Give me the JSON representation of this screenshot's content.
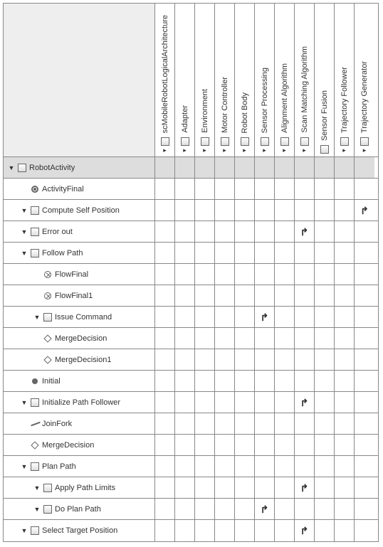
{
  "columns": [
    {
      "label": "scMobileRobotLogicalArchitecture",
      "has_arrow": true
    },
    {
      "label": "Adapter",
      "has_arrow": true
    },
    {
      "label": "Environment",
      "has_arrow": true
    },
    {
      "label": "Motor Controller",
      "has_arrow": true
    },
    {
      "label": "Robot Body",
      "has_arrow": true
    },
    {
      "label": "Sensor Processing",
      "has_arrow": true
    },
    {
      "label": "Alignment Algorithm",
      "has_arrow": true
    },
    {
      "label": "Scan Matching Algorithm",
      "has_arrow": true
    },
    {
      "label": "Sensor Fusion",
      "has_arrow": false
    },
    {
      "label": "Trajectory Follower",
      "has_arrow": true
    },
    {
      "label": "Trajectory Generator",
      "has_arrow": true
    }
  ],
  "rows": [
    {
      "label": "RobotActivity",
      "indent": 0,
      "expander": true,
      "icon": "checkbox",
      "shaded": true,
      "marks": {}
    },
    {
      "label": "ActivityFinal",
      "indent": 1,
      "expander": false,
      "icon": "bullseye",
      "shaded": false,
      "marks": {}
    },
    {
      "label": "Compute Self Position",
      "indent": 1,
      "expander": true,
      "icon": "checkbox",
      "shaded": false,
      "marks": {
        "10": true
      }
    },
    {
      "label": "Error out",
      "indent": 1,
      "expander": true,
      "icon": "checkbox",
      "shaded": false,
      "marks": {
        "7": true
      }
    },
    {
      "label": "Follow Path",
      "indent": 1,
      "expander": true,
      "icon": "checkbox",
      "shaded": false,
      "marks": {}
    },
    {
      "label": "FlowFinal",
      "indent": 2,
      "expander": false,
      "icon": "circle-x",
      "shaded": false,
      "marks": {}
    },
    {
      "label": "FlowFinal1",
      "indent": 2,
      "expander": false,
      "icon": "circle-x",
      "shaded": false,
      "marks": {}
    },
    {
      "label": "Issue Command",
      "indent": 2,
      "expander": true,
      "icon": "checkbox",
      "shaded": false,
      "marks": {
        "5": true
      }
    },
    {
      "label": "MergeDecision",
      "indent": 2,
      "expander": false,
      "icon": "diamond",
      "shaded": false,
      "marks": {}
    },
    {
      "label": "MergeDecision1",
      "indent": 2,
      "expander": false,
      "icon": "diamond",
      "shaded": false,
      "marks": {}
    },
    {
      "label": "Initial",
      "indent": 1,
      "expander": false,
      "icon": "dot",
      "shaded": false,
      "marks": {}
    },
    {
      "label": "Initialize Path Follower",
      "indent": 1,
      "expander": true,
      "icon": "checkbox",
      "shaded": false,
      "marks": {
        "7": true
      }
    },
    {
      "label": "JoinFork",
      "indent": 1,
      "expander": false,
      "icon": "slash",
      "shaded": false,
      "marks": {}
    },
    {
      "label": "MergeDecision",
      "indent": 1,
      "expander": false,
      "icon": "diamond",
      "shaded": false,
      "marks": {}
    },
    {
      "label": "Plan Path",
      "indent": 1,
      "expander": true,
      "icon": "checkbox",
      "shaded": false,
      "marks": {}
    },
    {
      "label": "Apply Path Limits",
      "indent": 2,
      "expander": true,
      "icon": "checkbox",
      "shaded": false,
      "marks": {
        "7": true
      }
    },
    {
      "label": "Do Plan Path",
      "indent": 2,
      "expander": true,
      "icon": "checkbox",
      "shaded": false,
      "marks": {
        "5": true
      }
    },
    {
      "label": "Select Target Position",
      "indent": 1,
      "expander": true,
      "icon": "checkbox",
      "shaded": false,
      "marks": {
        "7": true
      }
    }
  ],
  "glyphs": {
    "expander": "▼",
    "col_arrow": "▸",
    "mark": "↱"
  }
}
